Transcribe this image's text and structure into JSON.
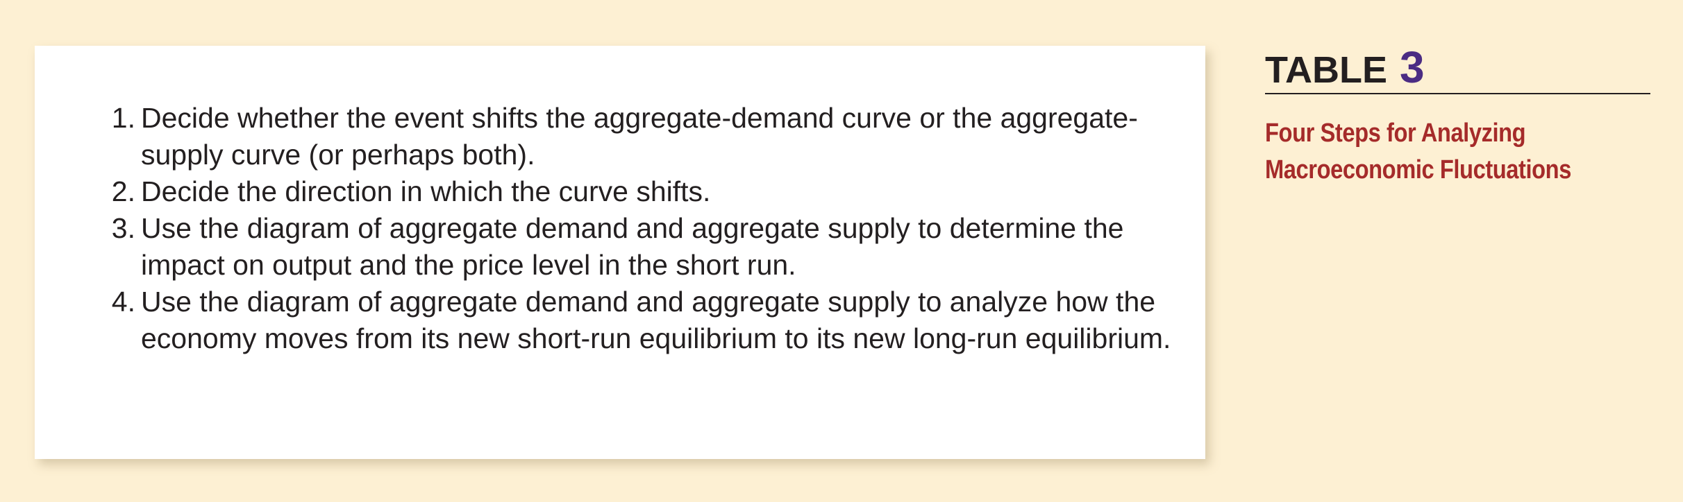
{
  "steps": [
    {
      "number": "1.",
      "text": "Decide whether the event shifts the aggregate-demand curve or the aggregate-supply curve (or perhaps both)."
    },
    {
      "number": "2.",
      "text": "Decide the direction in which the curve shifts."
    },
    {
      "number": "3.",
      "text": "Use the diagram of aggregate demand and aggregate supply to determine the impact on output and the price level in the short run."
    },
    {
      "number": "4.",
      "text": "Use the diagram of aggregate demand and aggregate supply to analyze how the economy moves from its new short-run equilibrium to its new long-run equilibrium."
    }
  ],
  "sidebar": {
    "table_word": "TABLE",
    "table_number": "3",
    "caption_line1": "Four Steps for Analyzing",
    "caption_line2": "Macroeconomic Fluctuations"
  },
  "colors": {
    "page_background": "#fdf0d3",
    "card_background": "#ffffff",
    "body_text": "#231f20",
    "table_number": "#4b2c83",
    "caption": "#a52b2a"
  }
}
